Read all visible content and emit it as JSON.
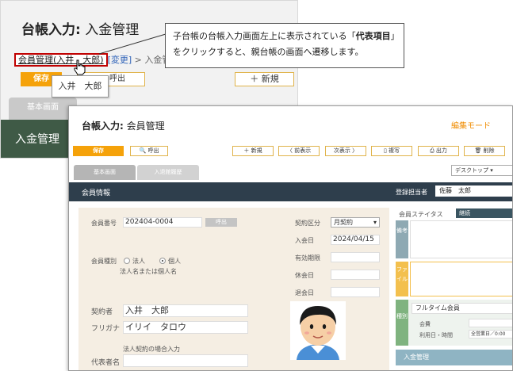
{
  "back_window": {
    "title_bold": "台帳入力:",
    "title_rest": " 入金管理",
    "breadcrumb_main": "会員管理(入井　大郎)",
    "breadcrumb_change": "[変更]",
    "breadcrumb_sep": " > 入金管",
    "save_label": "保存",
    "call_label": "呼出",
    "new_label": "＋ 新規",
    "tab_basic": "基本画面",
    "bar_title": "入金管理",
    "tooltip": "入井　大郎"
  },
  "callout": {
    "text_1": "子台帳の台帳入力画面左上に表示されている「",
    "text_bold": "代表項目",
    "text_2": "」をクリックすると、親台帳の画面へ遷移します。"
  },
  "front_window": {
    "title_bold": "台帳入力:",
    "title_rest": " 会員管理",
    "mode": "編集モード",
    "toolbar": {
      "save": "保存",
      "call": "🔍 呼出",
      "new": "＋ 新規",
      "prev": "〈 前表示",
      "next": "次表示 〉",
      "copy": "▯ 複写",
      "print": "⎙ 出力",
      "delete": "🗑 削除"
    },
    "tabs": [
      "基本画面",
      "入退館履歴"
    ],
    "view_select": "デスクトップ",
    "section": {
      "title": "会員情報",
      "staff_label": "登録担当者",
      "staff_value": "佐藤　太郎"
    },
    "form": {
      "member_no_label": "会員番号",
      "member_no": "202404-0004",
      "call_btn": "呼出",
      "member_type_label": "会員種別",
      "type_corp": "法人",
      "type_indiv": "個人",
      "type_hint": "法人名または個人名",
      "contractor_label": "契約者",
      "contractor": "入井　大郎",
      "furigana_label": "フリガナ",
      "furigana": "イリイ　タロウ",
      "corp_hint": "法人契約の場合入力",
      "rep_label": "代表者名",
      "contract_type_label": "契約区分",
      "contract_type": "月契約",
      "join_label": "入会日",
      "join_date": "2024/04/15",
      "expiry_label": "有効期限",
      "suspend_label": "休会日",
      "leave_label": "退会日"
    },
    "right": {
      "status_label": "会員ステイタス",
      "status_value": "継続",
      "remarks": "備考",
      "files": "ファイル",
      "kind": "種別",
      "plan": "フルタイム会員",
      "fee_label": "会費",
      "hours_label": "利用日・時間",
      "hours_value": "全営業日／0:00",
      "footer": "入金管理"
    }
  },
  "colors": {
    "accent_orange": "#f5a20a",
    "highlight_red": "#c00000",
    "bar_dark": "#2e3e4c",
    "bar_green": "#3f5a46"
  }
}
